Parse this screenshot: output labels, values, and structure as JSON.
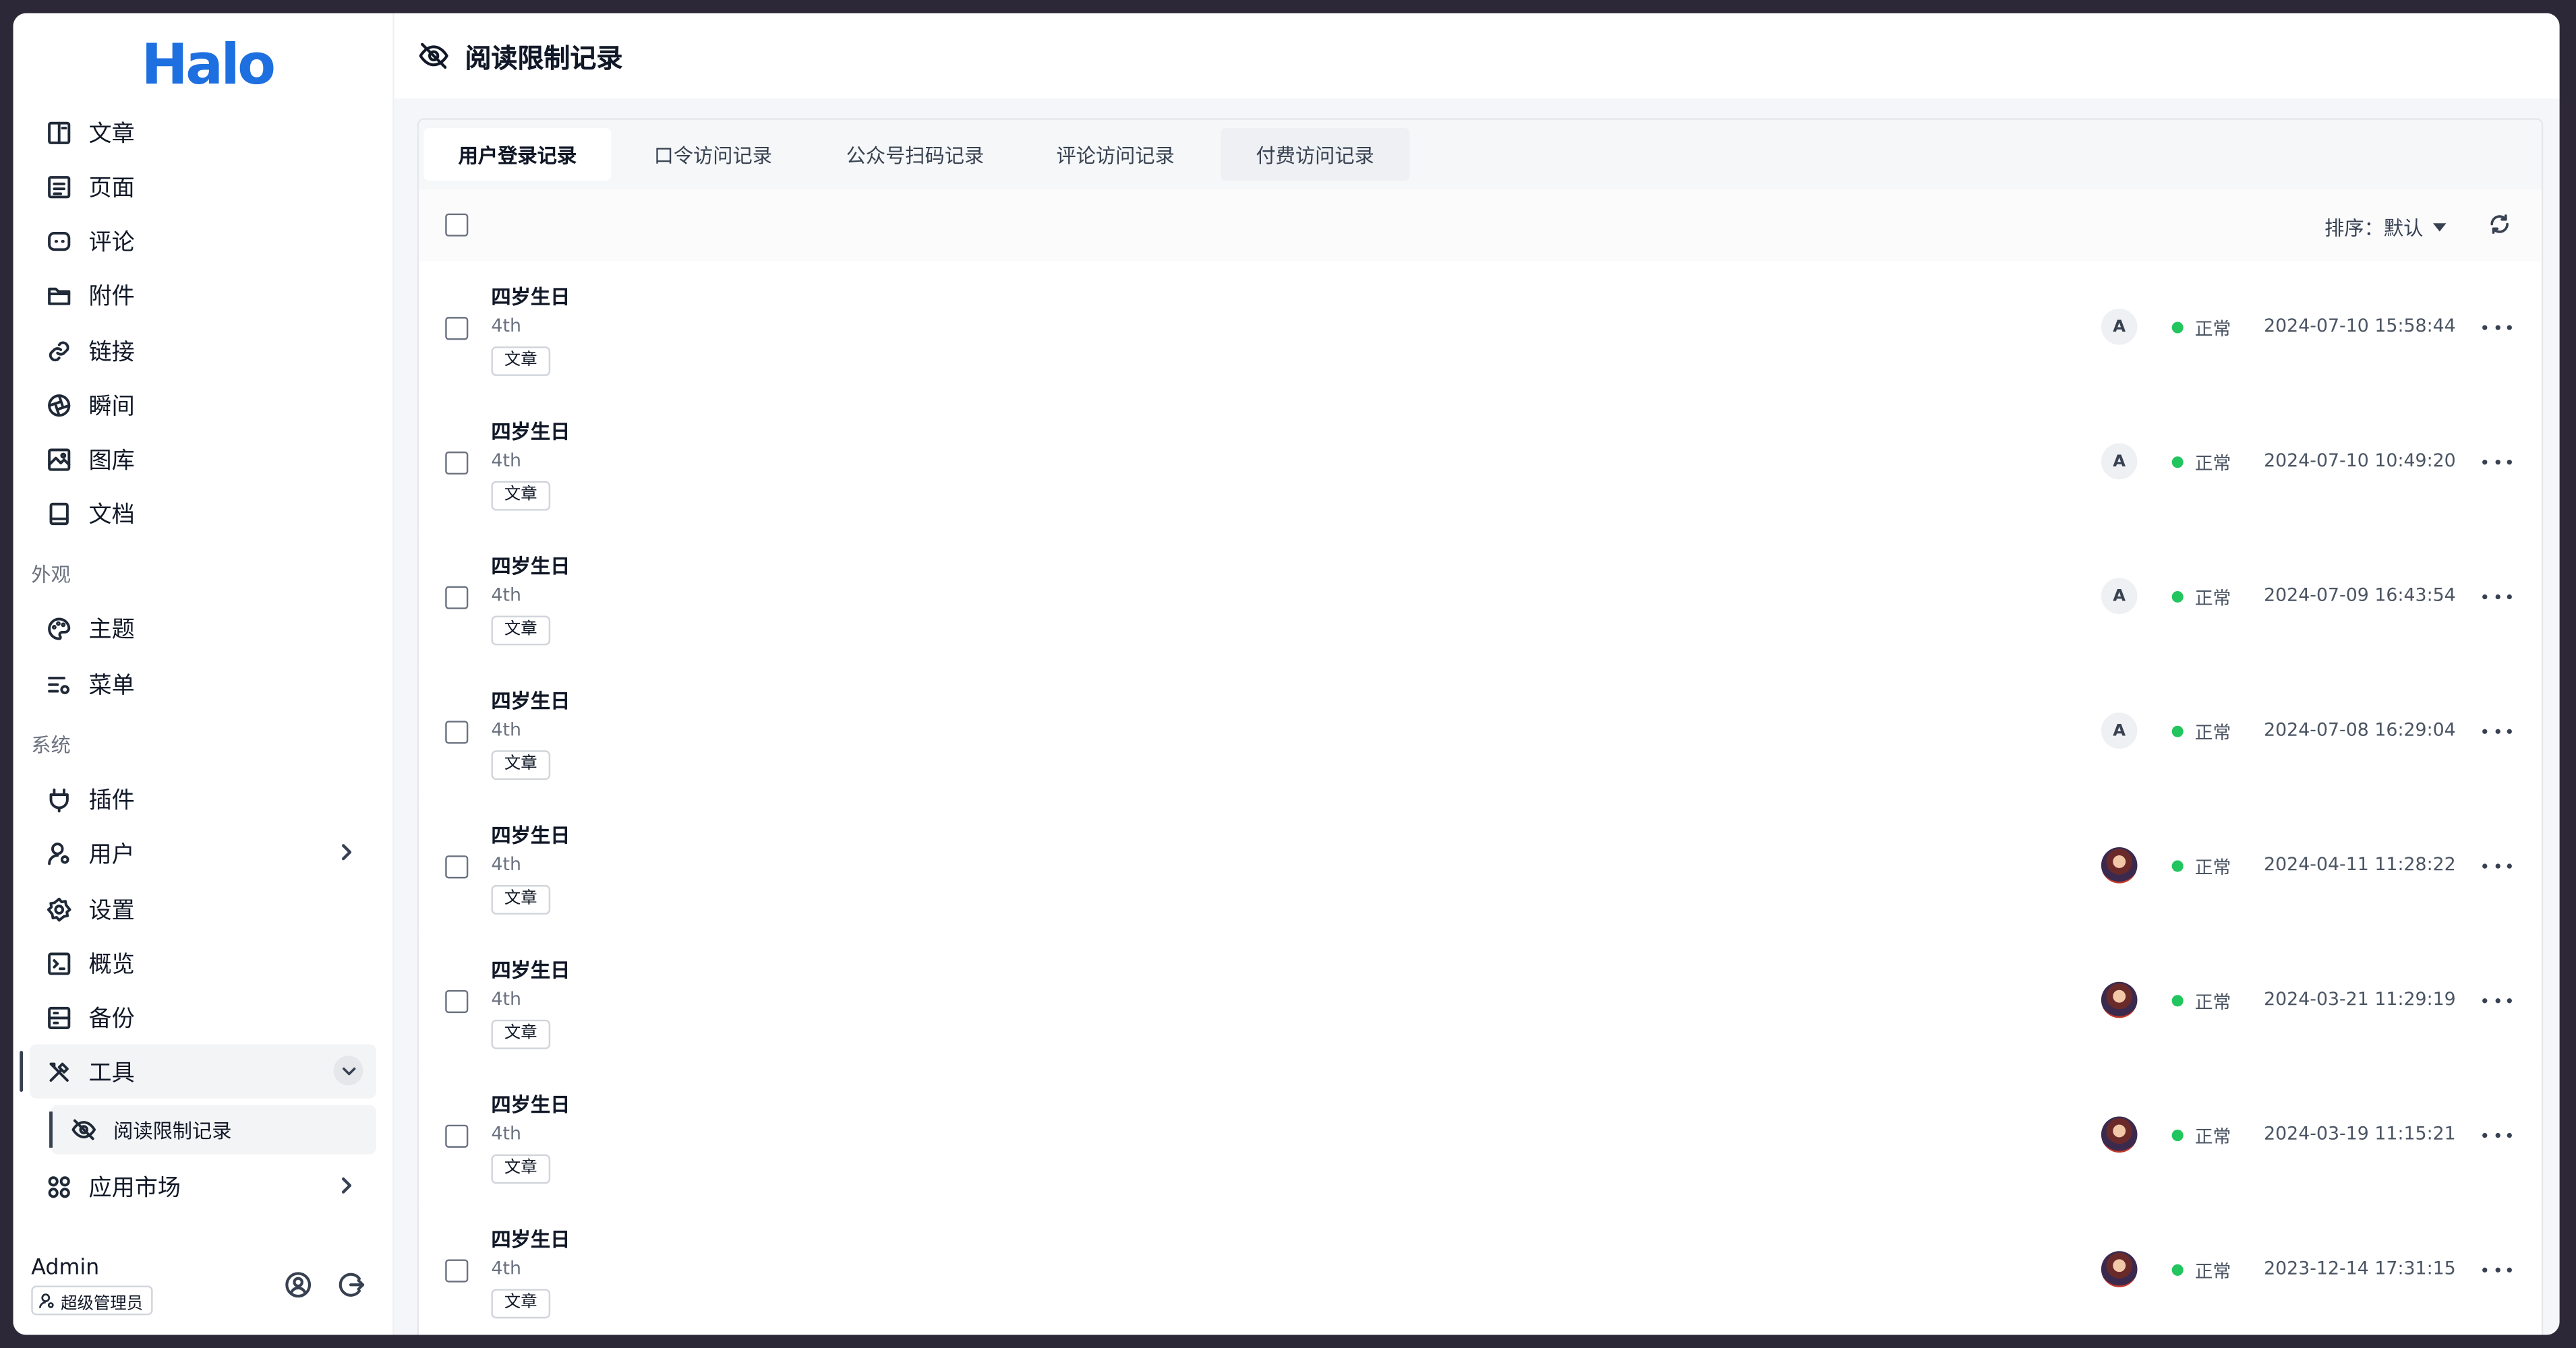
{
  "app": {
    "logo": "Halo"
  },
  "sidebar": {
    "items": [
      {
        "label": "文章",
        "icon": "book-icon"
      },
      {
        "label": "页面",
        "icon": "page-icon"
      },
      {
        "label": "评论",
        "icon": "comment-icon"
      },
      {
        "label": "附件",
        "icon": "folder-icon"
      },
      {
        "label": "链接",
        "icon": "link-icon"
      },
      {
        "label": "瞬间",
        "icon": "aperture-icon"
      },
      {
        "label": "图库",
        "icon": "gallery-icon"
      },
      {
        "label": "文档",
        "icon": "doc-icon"
      },
      {
        "label": "主题",
        "icon": "palette-icon"
      },
      {
        "label": "菜单",
        "icon": "menu-settings-icon"
      },
      {
        "label": "插件",
        "icon": "plug-icon"
      },
      {
        "label": "用户",
        "icon": "user-icon"
      },
      {
        "label": "设置",
        "icon": "gear-icon"
      },
      {
        "label": "概览",
        "icon": "terminal-icon"
      },
      {
        "label": "备份",
        "icon": "backup-icon"
      },
      {
        "label": "工具",
        "icon": "tools-icon"
      },
      {
        "label": "应用市场",
        "icon": "apps-icon"
      }
    ],
    "sections": {
      "appearance": "外观",
      "system": "系统"
    },
    "sub_item": {
      "label": "阅读限制记录",
      "icon": "eye-off-icon"
    },
    "user": {
      "name": "Admin",
      "role": "超级管理员"
    }
  },
  "page": {
    "title": "阅读限制记录"
  },
  "tabs": [
    "用户登录记录",
    "口令访问记录",
    "公众号扫码记录",
    "评论访问记录",
    "付费访问记录"
  ],
  "toolbar": {
    "sort_label": "排序：默认"
  },
  "records": [
    {
      "title": "四岁生日",
      "slug": "4th",
      "tag": "文章",
      "avatar": "A",
      "status": "正常",
      "time": "2024-07-10 15:58:44"
    },
    {
      "title": "四岁生日",
      "slug": "4th",
      "tag": "文章",
      "avatar": "A",
      "status": "正常",
      "time": "2024-07-10 10:49:20"
    },
    {
      "title": "四岁生日",
      "slug": "4th",
      "tag": "文章",
      "avatar": "A",
      "status": "正常",
      "time": "2024-07-09 16:43:54"
    },
    {
      "title": "四岁生日",
      "slug": "4th",
      "tag": "文章",
      "avatar": "A",
      "status": "正常",
      "time": "2024-07-08 16:29:04"
    },
    {
      "title": "四岁生日",
      "slug": "4th",
      "tag": "文章",
      "avatar": "",
      "status": "正常",
      "time": "2024-04-11 11:28:22"
    },
    {
      "title": "四岁生日",
      "slug": "4th",
      "tag": "文章",
      "avatar": "",
      "status": "正常",
      "time": "2024-03-21 11:29:19"
    },
    {
      "title": "四岁生日",
      "slug": "4th",
      "tag": "文章",
      "avatar": "",
      "status": "正常",
      "time": "2024-03-19 11:15:21"
    },
    {
      "title": "四岁生日",
      "slug": "4th",
      "tag": "文章",
      "avatar": "",
      "status": "正常",
      "time": "2023-12-14 17:31:15"
    }
  ],
  "colors": {
    "brand": "#1e6fe0",
    "status_ok": "#22c55e"
  }
}
